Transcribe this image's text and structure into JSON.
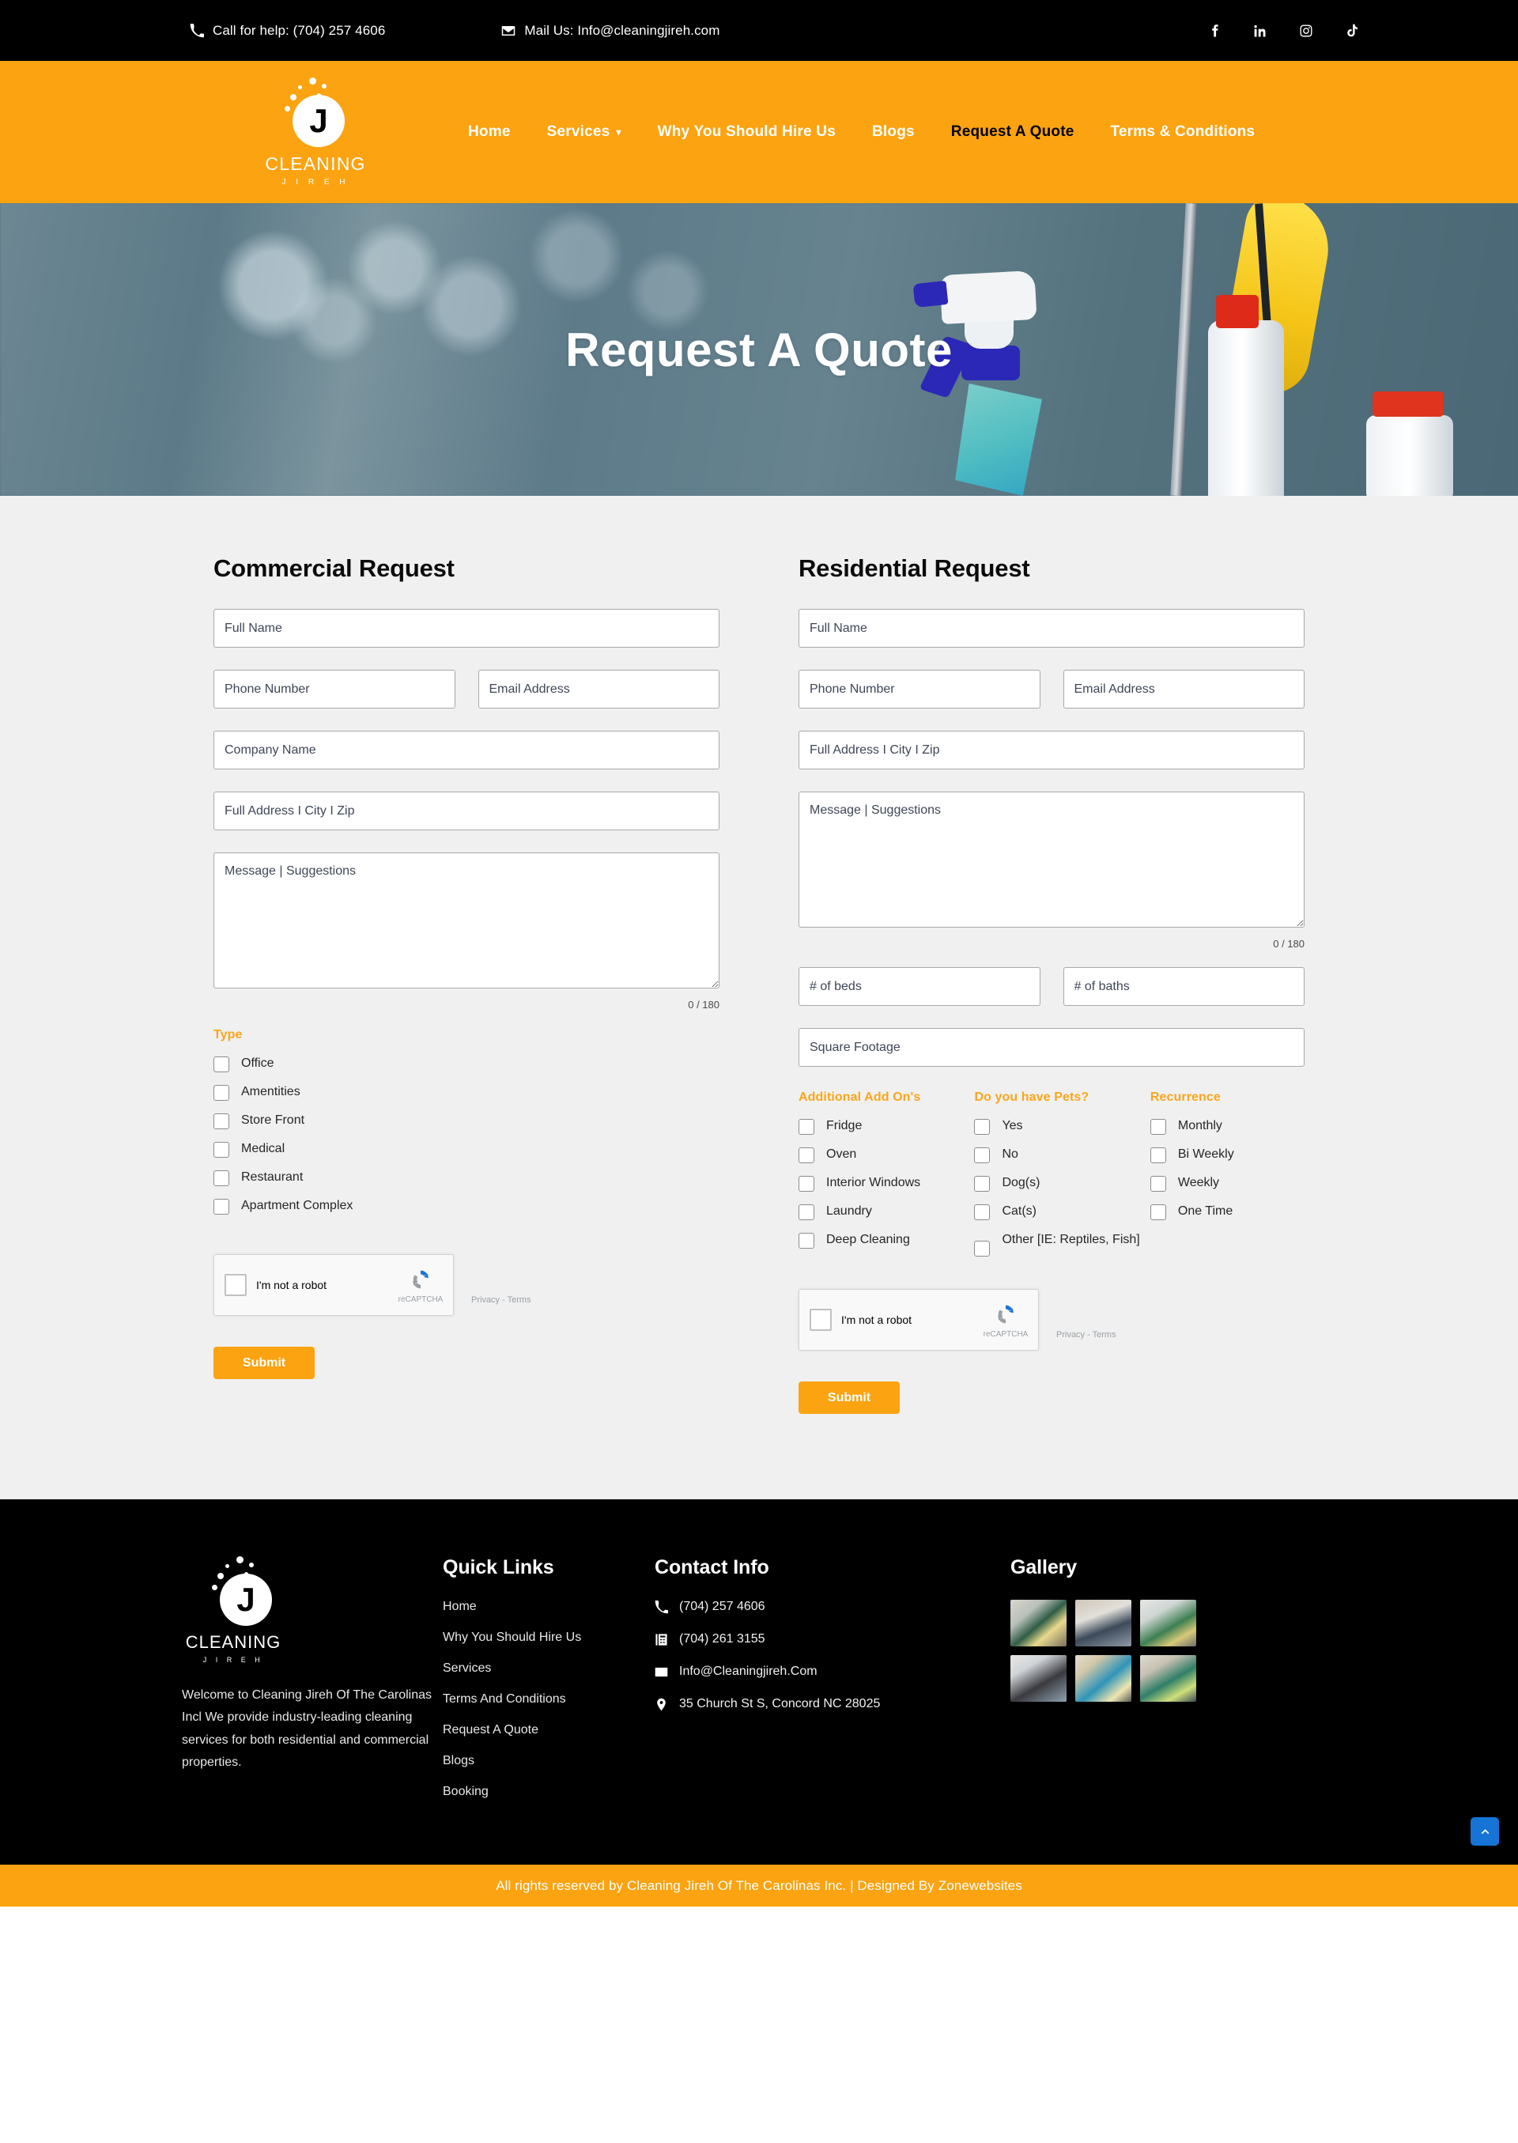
{
  "topbar": {
    "phone_label": "Call for help: (704) 257 4606",
    "mail_label": "Mail Us: Info@cleaningjireh.com",
    "socials": [
      {
        "name": "facebook-icon"
      },
      {
        "name": "linkedin-icon"
      },
      {
        "name": "instagram-icon"
      },
      {
        "name": "tiktok-icon"
      }
    ]
  },
  "logo": {
    "letter": "J",
    "name": "CLEANING",
    "sub": "J I R E H"
  },
  "nav": {
    "items": [
      {
        "label": "Home",
        "active": false,
        "caret": false
      },
      {
        "label": "Services",
        "active": false,
        "caret": true
      },
      {
        "label": "Why You Should Hire Us",
        "active": false,
        "caret": false
      },
      {
        "label": "Blogs",
        "active": false,
        "caret": false
      },
      {
        "label": "Request A Quote",
        "active": true,
        "caret": false
      },
      {
        "label": "Terms & Conditions",
        "active": false,
        "caret": false
      }
    ]
  },
  "hero": {
    "title": "Request A Quote"
  },
  "commercial": {
    "title": "Commercial Request",
    "full_name_placeholder": "Full Name",
    "phone_placeholder": "Phone Number",
    "email_placeholder": "Email Address",
    "company_placeholder": "Company Name",
    "address_placeholder": "Full Address I City I Zip",
    "message_placeholder": "Message | Suggestions",
    "counter": "0 / 180",
    "type_label": "Type",
    "types": [
      "Office",
      "Amentities",
      "Store Front",
      "Medical",
      "Restaurant",
      "Apartment Complex"
    ],
    "recaptcha_text": "I'm not a robot",
    "recaptcha_brand": "reCAPTCHA",
    "recaptcha_terms": "Privacy - Terms",
    "submit_label": "Submit"
  },
  "residential": {
    "title": "Residential Request",
    "full_name_placeholder": "Full Name",
    "phone_placeholder": "Phone Number",
    "email_placeholder": "Email Address",
    "address_placeholder": "Full Address I City I Zip",
    "message_placeholder": "Message | Suggestions",
    "counter": "0 / 180",
    "beds_placeholder": "# of beds",
    "baths_placeholder": "# of baths",
    "sqft_placeholder": "Square Footage",
    "addons_label": "Additional Add On's",
    "addons": [
      "Fridge",
      "Oven",
      "Interior Windows",
      "Laundry",
      "Deep Cleaning"
    ],
    "pets_label": "Do you have Pets?",
    "pets": [
      "Yes",
      "No",
      "Dog(s)",
      "Cat(s)",
      "Other [IE: Reptiles, Fish]"
    ],
    "recurrence_label": "Recurrence",
    "recurrence": [
      "Monthly",
      "Bi Weekly",
      "Weekly",
      "One Time"
    ],
    "recaptcha_text": "I'm not a robot",
    "recaptcha_brand": "reCAPTCHA",
    "recaptcha_terms": "Privacy - Terms",
    "submit_label": "Submit"
  },
  "footer": {
    "about_text": "Welcome to Cleaning Jireh Of The Carolinas Incl We provide industry-leading cleaning services for both residential and commercial properties.",
    "quick_links_title": "Quick Links",
    "quick_links": [
      "Home",
      "Why You Should Hire Us",
      "Services",
      "Terms And Conditions",
      "Request A Quote",
      "Blogs",
      "Booking"
    ],
    "contact_title": "Contact Info",
    "contact": [
      {
        "icon": "phone-icon",
        "text": "(704) 257 4606"
      },
      {
        "icon": "fax-icon",
        "text": "(704) 261 3155"
      },
      {
        "icon": "mail-icon",
        "text": "Info@Cleaningjireh.Com"
      },
      {
        "icon": "location-pin-icon",
        "text": "35 Church St S, Concord NC 28025"
      }
    ],
    "gallery_title": "Gallery",
    "gallery_count": 6
  },
  "bottombar": {
    "text": "All rights reserved by Cleaning Jireh Of The Carolinas Inc. | Designed By Zonewebsites"
  },
  "colors": {
    "brand_orange": "#FCA311",
    "accent_orange": "#FAA61A",
    "black": "#000000",
    "page_bg": "#f0f0f0",
    "scroll_top_blue": "#1574d6"
  }
}
